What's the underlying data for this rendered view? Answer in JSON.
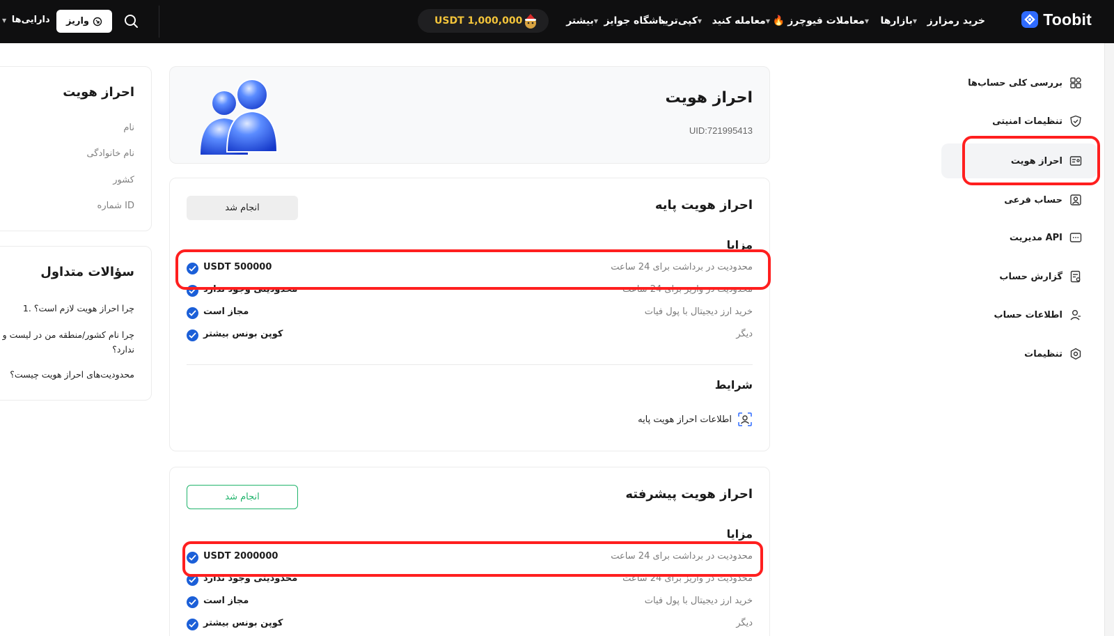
{
  "topbar": {
    "brand": "Toobit",
    "nav": {
      "buy_crypto": "خرید رمزارز",
      "markets": "بازارها",
      "futures": "معاملات فیوچرز",
      "trade": "معامله کنید",
      "copy_trade": "کپی‌ترید",
      "rewards": "باشگاه جوایز",
      "more": "بیشتر"
    },
    "balance": "USDT 1,000,000",
    "deposit_label": "واریز",
    "assets_label": "دارایی‌ها"
  },
  "sidebar": {
    "items": [
      {
        "label": "بررسی کلی حساب‌ها",
        "icon": "dashboard-icon"
      },
      {
        "label": "تنظیمات امنیتی",
        "icon": "shield-icon"
      },
      {
        "label": "احراز هویت",
        "icon": "id-card-icon"
      },
      {
        "label": "حساب فرعی",
        "icon": "sub-account-icon"
      },
      {
        "label": "مدیریت API",
        "icon": "api-icon"
      },
      {
        "label": "گزارش حساب",
        "icon": "report-icon"
      },
      {
        "label": "اطلاعات حساب",
        "icon": "user-icon"
      },
      {
        "label": "تنظیمات",
        "icon": "settings-icon"
      }
    ]
  },
  "header": {
    "title": "احراز هویت",
    "uid": "UID:721995413"
  },
  "basic": {
    "title": "احراز هویت پایه",
    "status": "انجام شد",
    "benefits_title": "مزایا",
    "rows": [
      {
        "key": "محدودیت در برداشت برای 24 ساعت",
        "value": "USDT 500000"
      },
      {
        "key": "محدودیت در واریز برای 24 ساعت",
        "value": "محدودیتی وجود ندارد"
      },
      {
        "key": "خرید ارز دیجیتال با پول فیات",
        "value": "مجاز است"
      },
      {
        "key": "دیگر",
        "value": "کوپن بونس بیشتر"
      }
    ],
    "conditions_title": "شرایط",
    "condition_item": "اطلاعات احراز هویت پایه"
  },
  "advanced": {
    "title": "احراز هویت پیشرفته",
    "status": "انجام شد",
    "benefits_title": "مزایا",
    "rows": [
      {
        "key": "محدودیت در برداشت برای 24 ساعت",
        "value": "USDT 2000000"
      },
      {
        "key": "محدودیت در واریز برای 24 ساعت",
        "value": "محدودیتی وجود ندارد"
      },
      {
        "key": "خرید ارز دیجیتال با پول فیات",
        "value": "مجاز است"
      },
      {
        "key": "دیگر",
        "value": "کوپن بونس بیشتر"
      }
    ]
  },
  "identity_card": {
    "title": "احراز هویت",
    "fields": [
      "نام",
      "نام خانوادگی",
      "کشور",
      "شماره ID"
    ]
  },
  "faq": {
    "title": "سؤالات متداول",
    "q1": "1. چرا احراز هویت لازم است؟",
    "q2_line1": "چرا نام کشور/منطقه من در لیست و",
    "q2_line2": "ندارد؟",
    "q3": "محدودیت‌های احراز هویت چیست؟"
  },
  "colors": {
    "topbar_bg": "#0f0f10",
    "balance_text": "#f3c43a",
    "check_blue": "#1b5fd8",
    "success_green": "#1fb36b",
    "annotation_red": "#ff1f1f"
  }
}
